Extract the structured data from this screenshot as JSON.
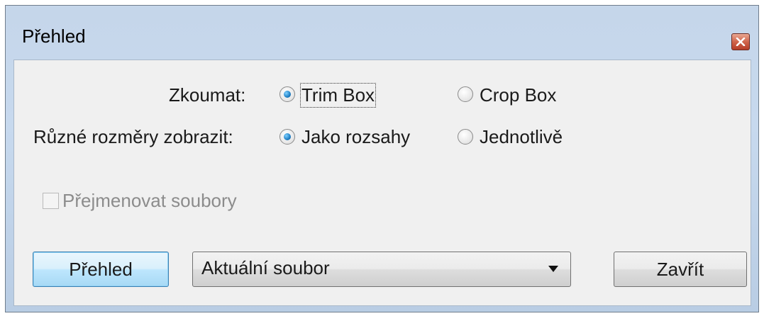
{
  "window": {
    "title": "Přehled"
  },
  "form": {
    "examine": {
      "label": "Zkoumat:",
      "options": [
        {
          "label": "Trim Box",
          "selected": true
        },
        {
          "label": "Crop Box",
          "selected": false
        }
      ]
    },
    "sizes": {
      "label": "Různé rozměry zobrazit:",
      "options": [
        {
          "label": "Jako rozsahy",
          "selected": true
        },
        {
          "label": "Jednotlivě",
          "selected": false
        }
      ]
    },
    "rename": {
      "label": "Přejmenovat soubory",
      "checked": false,
      "enabled": false
    }
  },
  "footer": {
    "preview_button": "Přehled",
    "scope_select": "Aktuální soubor",
    "close_button": "Zavřít"
  },
  "colors": {
    "accent": "#3c7fb1",
    "radio_dot": "#1f7fc4"
  },
  "icons": {
    "close": "close-icon",
    "dropdown": "chevron-down-icon"
  }
}
